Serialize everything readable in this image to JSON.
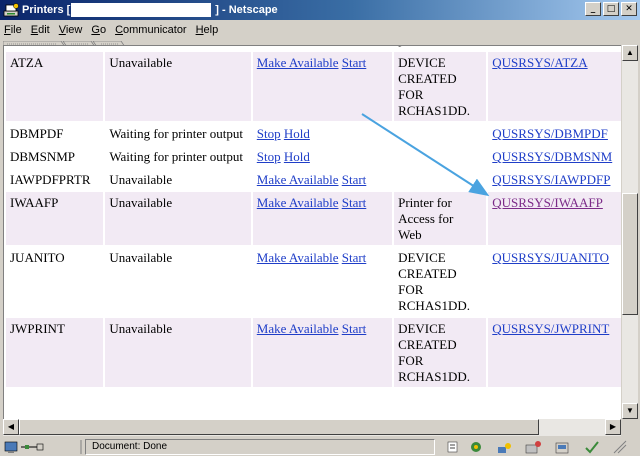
{
  "window": {
    "title_prefix": "Printers [",
    "title_suffix": "] - Netscape",
    "buttons": {
      "minimize": "_",
      "maximize": "□",
      "close": "✕"
    }
  },
  "menu": [
    {
      "accel": "F",
      "rest": "ile"
    },
    {
      "accel": "E",
      "rest": "dit"
    },
    {
      "accel": "V",
      "rest": "iew"
    },
    {
      "accel": "G",
      "rest": "o"
    },
    {
      "accel": "C",
      "rest": "ommunicator"
    },
    {
      "accel": "H",
      "rest": "elp"
    }
  ],
  "table": {
    "partial_top_text": "printer",
    "rows": [
      {
        "name": "ATZA",
        "status": "Unavailable",
        "action1": "Make Available",
        "action2": "Start",
        "desc_lines": [
          "DEVICE",
          "CREATED",
          "FOR",
          "RCHAS1DD."
        ],
        "queue": "QUSRSYS/ATZA",
        "shade": true,
        "visited": false
      },
      {
        "name": "DBMPDF",
        "status": "Waiting for printer output",
        "action1": "Stop",
        "action2": "Hold",
        "desc_lines": [],
        "queue": "QUSRSYS/DBMPDF",
        "shade": false,
        "visited": false
      },
      {
        "name": "DBMSNMP",
        "status": "Waiting for printer output",
        "action1": "Stop",
        "action2": "Hold",
        "desc_lines": [],
        "queue": "QUSRSYS/DBMSNM",
        "shade": false,
        "visited": false
      },
      {
        "name": "IAWPDFPRTR",
        "status": "Unavailable",
        "action1": "Make Available",
        "action2": "Start",
        "desc_lines": [],
        "queue": "QUSRSYS/IAWPDFP",
        "shade": false,
        "visited": false
      },
      {
        "name": "IWAAFP",
        "status": "Unavailable",
        "action1": "Make Available",
        "action2": "Start",
        "desc_lines": [
          "Printer for",
          "Access for",
          "Web"
        ],
        "queue": "QUSRSYS/IWAAFP",
        "shade": true,
        "visited": true
      },
      {
        "name": "JUANITO",
        "status": "Unavailable",
        "action1": "Make Available",
        "action2": "Start",
        "desc_lines": [
          "DEVICE",
          "CREATED",
          "FOR",
          "RCHAS1DD."
        ],
        "queue": "QUSRSYS/JUANITO",
        "shade": false,
        "visited": false
      },
      {
        "name": "JWPRINT",
        "status": "Unavailable",
        "action1": "Make Available",
        "action2": "Start",
        "desc_lines": [
          "DEVICE",
          "CREATED",
          "FOR",
          "RCHAS1DD."
        ],
        "queue": "QUSRSYS/JWPRINT",
        "shade": true,
        "visited": false
      }
    ]
  },
  "statusbar": {
    "text": "Document: Done"
  },
  "colors": {
    "link": "#1f3ec8",
    "visited": "#7b2a88",
    "row_shade": "#f2eaf4",
    "arrow": "#4aa3e0"
  }
}
